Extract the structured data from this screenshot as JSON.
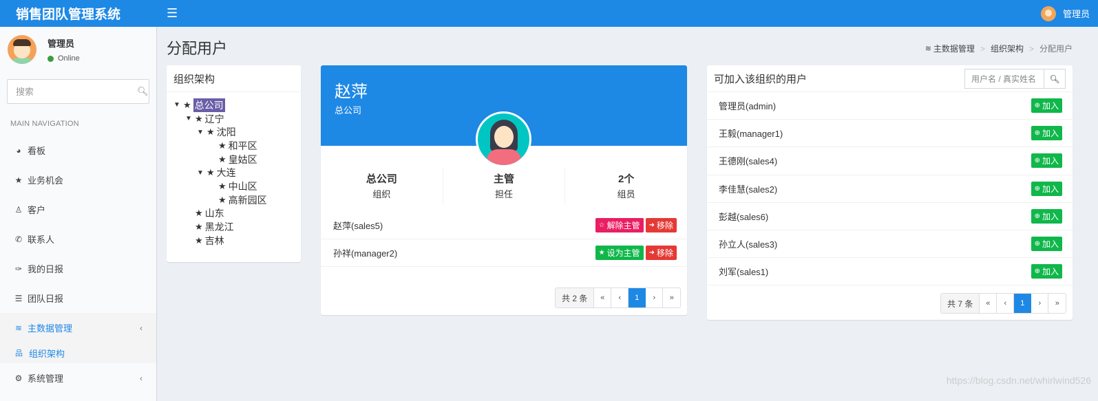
{
  "header": {
    "brand": "销售团队管理系统",
    "menu_icon": "☰",
    "user_name": "管理员"
  },
  "sidebar": {
    "user": {
      "name": "管理员",
      "status": "Online"
    },
    "search_placeholder": "搜索",
    "nav_header": "MAIN NAVIGATION",
    "items": [
      {
        "icon": "dashboard-icon",
        "glyph": "◕",
        "label": "看板"
      },
      {
        "icon": "star-icon",
        "glyph": "★",
        "label": "业务机会"
      },
      {
        "icon": "user-icon",
        "glyph": "♙",
        "label": "客户"
      },
      {
        "icon": "phone-icon",
        "glyph": "✆",
        "label": "联系人"
      },
      {
        "icon": "thumbtack-icon",
        "glyph": "✑",
        "label": "我的日报"
      },
      {
        "icon": "list-icon",
        "glyph": "☰",
        "label": "团队日报"
      },
      {
        "icon": "database-icon",
        "glyph": "≋",
        "label": "主数据管理",
        "active": true
      },
      {
        "icon": "cogs-icon",
        "glyph": "⚙",
        "label": "系统管理"
      }
    ],
    "sub_item": {
      "icon": "sitemap-icon",
      "glyph": "品",
      "label": "组织架构"
    }
  },
  "page": {
    "title": "分配用户",
    "breadcrumb": [
      "主数据管理",
      "组织架构",
      "分配用户"
    ]
  },
  "tree": {
    "title": "组织架构",
    "nodes": [
      {
        "label": "总公司",
        "level": 0,
        "expanded": true,
        "selected": true
      },
      {
        "label": "辽宁",
        "level": 1,
        "expanded": true
      },
      {
        "label": "沈阳",
        "level": 2,
        "expanded": true
      },
      {
        "label": "和平区",
        "level": 3
      },
      {
        "label": "皇姑区",
        "level": 3
      },
      {
        "label": "大连",
        "level": 2,
        "expanded": true
      },
      {
        "label": "中山区",
        "level": 3
      },
      {
        "label": "高新园区",
        "level": 3
      },
      {
        "label": "山东",
        "level": 1
      },
      {
        "label": "黑龙江",
        "level": 1
      },
      {
        "label": "吉林",
        "level": 1
      }
    ]
  },
  "profile": {
    "name": "赵萍",
    "org": "总公司",
    "stats": [
      {
        "value": "总公司",
        "label": "组织"
      },
      {
        "value": "主管",
        "label": "担任"
      },
      {
        "value": "2个",
        "label": "组员"
      }
    ],
    "members": [
      {
        "name": "赵萍(sales5)",
        "primary_label": "解除主管",
        "primary_icon": "☆",
        "primary_style": "pink",
        "remove_label": "移除"
      },
      {
        "name": "孙祥(manager2)",
        "primary_label": "设为主管",
        "primary_icon": "★",
        "primary_style": "green",
        "remove_label": "移除"
      }
    ],
    "pager": {
      "info": "共 2 条",
      "first": "«",
      "prev": "‹",
      "current": "1",
      "next": "›",
      "last": "»"
    }
  },
  "available": {
    "title": "可加入该组织的用户",
    "search_placeholder": "用户名 / 真实姓名",
    "add_label": "加入",
    "users": [
      "管理员(admin)",
      "王毅(manager1)",
      "王德刚(sales4)",
      "李佳慧(sales2)",
      "彭越(sales6)",
      "孙立人(sales3)",
      "刘军(sales1)"
    ],
    "pager": {
      "info": "共 7 条",
      "first": "«",
      "prev": "‹",
      "current": "1",
      "next": "›",
      "last": "»"
    }
  },
  "watermark": "https://blog.csdn.net/whirlwind526",
  "colors": {
    "primary": "#1e88e5",
    "success": "#10b74a",
    "danger": "#e53935",
    "pink": "#e91e63",
    "tree_selected": "#6a5ea8"
  }
}
